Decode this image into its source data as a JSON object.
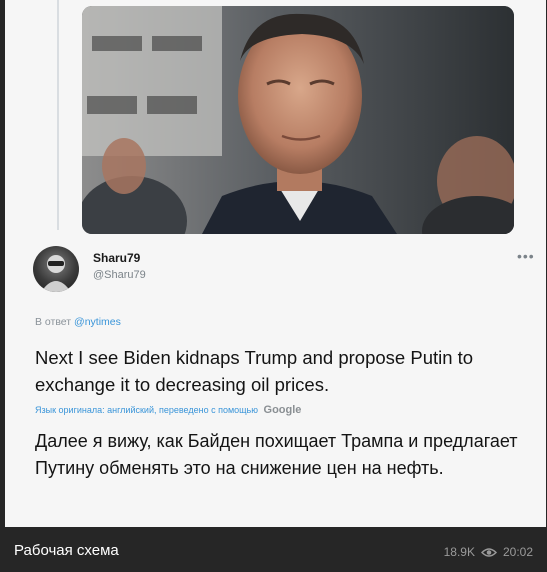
{
  "tweet": {
    "display_name": "Sharu79",
    "handle": "@Sharu79",
    "reply_prefix": "В ответ",
    "reply_mention": "@nytimes",
    "more_icon": "more-horizontal-icon",
    "text_original": "Next I see Biden kidnaps Trump and propose Putin to exchange it to decreasing oil prices.",
    "translation_note": "Язык оригинала: английский, переведено с помощью",
    "translation_brand": "Google",
    "text_translated": "Далее я вижу, как Байден похищает Трампа и предлагает Путину обменять это на снижение цен на нефть."
  },
  "post": {
    "caption": "Рабочая схема",
    "views": "18.9K",
    "views_icon": "eye-icon",
    "time": "20:02"
  },
  "colors": {
    "link": "#3a95d9",
    "frame_bg": "#262626",
    "card_bg": "#f6f6f6"
  }
}
